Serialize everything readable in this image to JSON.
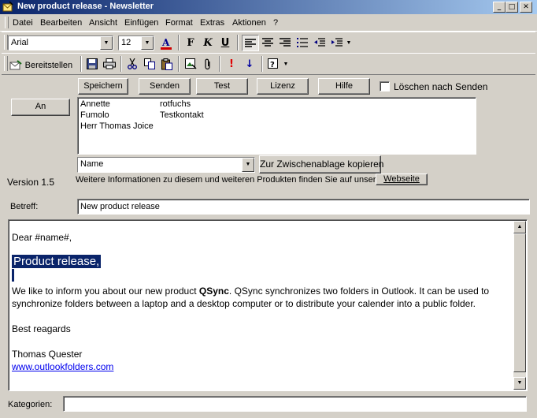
{
  "window": {
    "title": "New product release - Newsletter"
  },
  "menu": [
    "Datei",
    "Bearbeiten",
    "Ansicht",
    "Einfügen",
    "Format",
    "Extras",
    "Aktionen",
    "?"
  ],
  "format_toolbar": {
    "font": "Arial",
    "size": "12"
  },
  "std_toolbar": {
    "send_label": "Bereitstellen"
  },
  "actions": {
    "speichern": "Speichern",
    "senden": "Senden",
    "test": "Test",
    "lizenz": "Lizenz",
    "hilfe": "Hilfe",
    "delete_after_send": "Löschen nach Senden"
  },
  "an_button": "An",
  "recipients": [
    {
      "name": "Annette",
      "info": "rotfuchs"
    },
    {
      "name": "Fumolo",
      "info": "Testkontakt"
    },
    {
      "name": "Herr Thomas Joice",
      "info": ""
    }
  ],
  "field_select": {
    "value": "Name"
  },
  "copy_button": "Zur Zwischenablage kopieren",
  "version": "Version 1.5",
  "info_text": "Weitere Informationen zu diesem und weiteren Produkten finden Sie auf unserer",
  "website_button": "Webseite",
  "subject": {
    "label": "Betreff:",
    "value": "New product release"
  },
  "body": {
    "greeting": "Dear #name#,",
    "heading": "Product release,",
    "para_before": "We like to inform you about our new product ",
    "product": "QSync",
    "para_after": ". QSync synchronizes two folders in Outlook. It can be used to synchronize folders between a laptop and a desktop computer or to distribute your calender into a public folder.",
    "closing": "Best reagards",
    "signature": "Thomas Quester",
    "link": "www.outlookfolders.com"
  },
  "categories": {
    "label": "Kategorien:",
    "value": ""
  },
  "colors": {
    "title_start": "#0a246a",
    "title_end": "#a6caf0",
    "selection": "#0a246a",
    "link": "#0000ee"
  }
}
